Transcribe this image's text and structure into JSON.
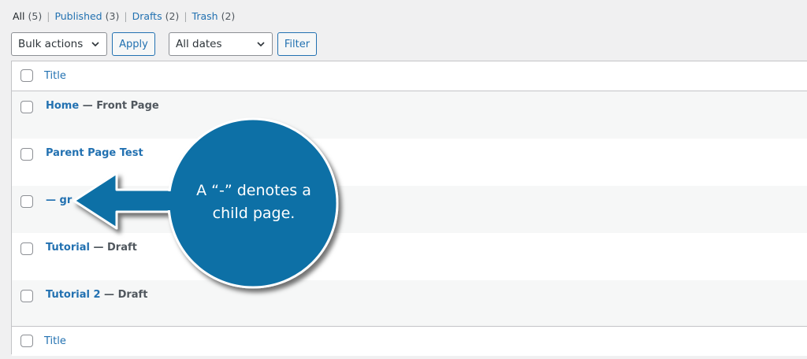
{
  "filters": [
    {
      "label": "All",
      "count": "(5)",
      "current": true
    },
    {
      "label": "Published",
      "count": "(3)",
      "current": false
    },
    {
      "label": "Drafts",
      "count": "(2)",
      "current": false
    },
    {
      "label": "Trash",
      "count": "(2)",
      "current": false
    }
  ],
  "filter_separator": "|",
  "toolbar": {
    "bulk_actions": "Bulk actions",
    "apply": "Apply",
    "dates": "All dates",
    "filter": "Filter"
  },
  "table": {
    "column_title": "Title",
    "rows": [
      {
        "title": "Home",
        "state": " — Front Page"
      },
      {
        "title": "Parent Page Test",
        "state": ""
      },
      {
        "title": "— gr",
        "state": ""
      },
      {
        "title": "Tutorial",
        "state": " — Draft"
      },
      {
        "title": "Tutorial 2",
        "state": " — Draft"
      }
    ]
  },
  "callout": {
    "line1": "A “-” denotes a",
    "line2": "child page.",
    "color": "#0f6fa6"
  }
}
